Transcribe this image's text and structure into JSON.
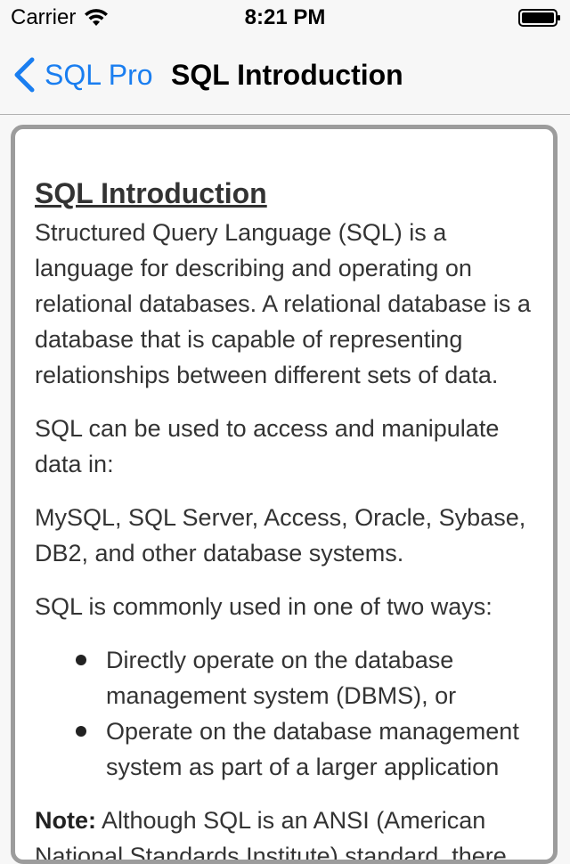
{
  "status_bar": {
    "carrier": "Carrier",
    "time": "8:21 PM",
    "icons": [
      "wifi-icon",
      "battery-icon"
    ]
  },
  "nav": {
    "back_label": "SQL Pro",
    "back_icon": "chevron-left-icon",
    "title": "SQL Introduction",
    "accent_color": "#1a7ef0"
  },
  "article": {
    "heading": "SQL Introduction",
    "paragraphs": [
      "Structured Query Language (SQL) is a language for describing and operating on relational databases. A relational database is a database that is capable of representing relationships between different sets of data.",
      "SQL can be used to access and manipulate data in:",
      "MySQL, SQL Server, Access, Oracle, Sybase, DB2, and other database systems.",
      "SQL is commonly used in one of two ways:"
    ],
    "bullets": [
      "Directly operate on the database management system (DBMS), or",
      "Operate on the database management system as part of a larger application"
    ],
    "note_label": "Note:",
    "note_text": "Although SQL is an ANSI (American National Standards Institute) standard, there"
  }
}
